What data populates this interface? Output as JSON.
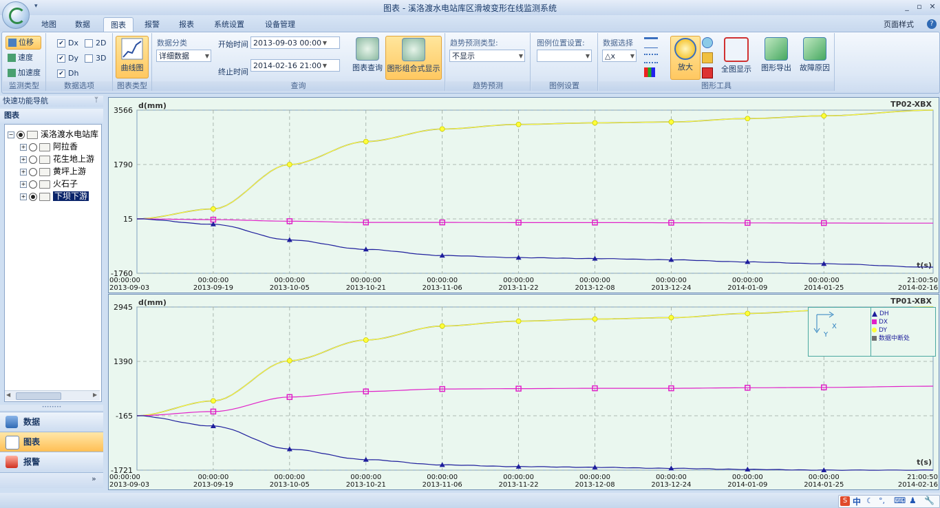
{
  "window": {
    "title": "图表 - 溪洛渡水电站库区滑坡变形在线监测系统",
    "min": "_",
    "max": "▫",
    "close": "✕"
  },
  "tabs": [
    {
      "label": "地图"
    },
    {
      "label": "数据"
    },
    {
      "label": "图表"
    },
    {
      "label": "报警"
    },
    {
      "label": "报表"
    },
    {
      "label": "系统设置"
    },
    {
      "label": "设备管理"
    }
  ],
  "active_tab": "图表",
  "page_style": "页面样式",
  "ribbon": {
    "monitor_type": {
      "label": "监测类型",
      "items": [
        "位移",
        "速度",
        "加速度"
      ]
    },
    "data_options": {
      "label": "数据选项",
      "checks": [
        "Dx",
        "Dy",
        "Dh"
      ],
      "modes": [
        "2D",
        "3D"
      ]
    },
    "chart_type": {
      "label": "图表类型",
      "button": "曲线图"
    },
    "query": {
      "label": "查询",
      "category_label": "数据分类",
      "category_value": "详细数据",
      "start_label": "开始时间",
      "start_value": "2013-09-03 00:00",
      "end_label": "终止时间",
      "end_value": "2014-02-16 21:00",
      "query_button": "图表查询",
      "combo_button": "图形组合式显示"
    },
    "trend": {
      "label": "趋势预测",
      "type_label": "趋势预测类型:",
      "type_value": "不显示"
    },
    "legend": {
      "label": "图例设置",
      "pos_label": "图例位置设置:",
      "pos_value": ""
    },
    "tools": {
      "label": "图形工具",
      "data_select_label": "数据选择",
      "data_select_value": "△x",
      "zoom": "放大",
      "fullview": "全图显示",
      "export": "图形导出",
      "fault": "故障原因"
    }
  },
  "nav": {
    "header": "快速功能导航",
    "pin": "ᛘ",
    "tree_title": "图表",
    "tree": [
      {
        "label": "溪洛渡水电站库",
        "level": 0,
        "selected": false,
        "checked": true
      },
      {
        "label": "阿拉香",
        "level": 1,
        "selected": false,
        "checked": false
      },
      {
        "label": "花生地上游",
        "level": 1,
        "selected": false,
        "checked": false
      },
      {
        "label": "黄坪上游",
        "level": 1,
        "selected": false,
        "checked": false
      },
      {
        "label": "火石子",
        "level": 1,
        "selected": false,
        "checked": false
      },
      {
        "label": "下坝下游",
        "level": 1,
        "selected": true,
        "checked": true
      }
    ],
    "buttons": [
      {
        "label": "数据"
      },
      {
        "label": "图表"
      },
      {
        "label": "报警"
      }
    ],
    "more": "»"
  },
  "x_ticks": [
    {
      "time": "00:00:00",
      "date": "2013-09-03"
    },
    {
      "time": "00:00:00",
      "date": "2013-09-19"
    },
    {
      "time": "00:00:00",
      "date": "2013-10-05"
    },
    {
      "time": "00:00:00",
      "date": "2013-10-21"
    },
    {
      "time": "00:00:00",
      "date": "2013-11-06"
    },
    {
      "time": "00:00:00",
      "date": "2013-11-22"
    },
    {
      "time": "00:00:00",
      "date": "2013-12-08"
    },
    {
      "time": "00:00:00",
      "date": "2013-12-24"
    },
    {
      "time": "00:00:00",
      "date": "2014-01-09"
    },
    {
      "time": "00:00:00",
      "date": "2014-01-25"
    },
    {
      "time": "21:00:50",
      "date": "2014-02-16"
    }
  ],
  "legend_items": [
    {
      "label": "DH",
      "color": "#1e1e9c",
      "marker": "triangle"
    },
    {
      "label": "DX",
      "color": "#e020c8",
      "marker": "square"
    },
    {
      "label": "DY",
      "color": "#ffff3a",
      "marker": "circle"
    },
    {
      "label": "数据中断处",
      "color": "#707070",
      "marker": "square"
    }
  ],
  "axis_icon": {
    "x": "X",
    "y": "Y"
  },
  "chart_data": [
    {
      "type": "line",
      "title": "TP02-XBX",
      "ylabel": "d(mm)",
      "xlabel": "t(s)",
      "yticks": [
        3566,
        1790,
        15,
        -1760
      ],
      "ylim": [
        -1760,
        3566
      ],
      "x": [
        0,
        16,
        32,
        48,
        64,
        80,
        96,
        112,
        128,
        144,
        166.9
      ],
      "series": [
        {
          "name": "DY",
          "color": "#ffff3a",
          "values": [
            15,
            340,
            1790,
            2540,
            2950,
            3100,
            3150,
            3180,
            3290,
            3380,
            3566
          ]
        },
        {
          "name": "DX",
          "color": "#e020c8",
          "values": [
            15,
            -10,
            -60,
            -100,
            -100,
            -105,
            -105,
            -110,
            -115,
            -120,
            -125
          ]
        },
        {
          "name": "DH",
          "color": "#1e1e9c",
          "values": [
            15,
            -160,
            -670,
            -980,
            -1180,
            -1250,
            -1280,
            -1320,
            -1390,
            -1450,
            -1560
          ]
        }
      ]
    },
    {
      "type": "line",
      "title": "TP01-XBX",
      "ylabel": "d(mm)",
      "xlabel": "t(s)",
      "yticks": [
        2945,
        1390,
        -165,
        -1721
      ],
      "ylim": [
        -1721,
        2945
      ],
      "x": [
        0,
        16,
        32,
        48,
        64,
        80,
        96,
        112,
        128,
        144,
        166.9
      ],
      "series": [
        {
          "name": "DY",
          "color": "#ffff3a",
          "values": [
            -165,
            260,
            1410,
            2000,
            2400,
            2540,
            2600,
            2640,
            2760,
            2850,
            2945
          ]
        },
        {
          "name": "DX",
          "color": "#e020c8",
          "values": [
            -165,
            -45,
            370,
            530,
            600,
            610,
            620,
            620,
            635,
            645,
            680
          ]
        },
        {
          "name": "DH",
          "color": "#1e1e9c",
          "values": [
            -165,
            -460,
            -1120,
            -1420,
            -1570,
            -1620,
            -1640,
            -1670,
            -1700,
            -1720,
            -1721
          ]
        }
      ]
    }
  ],
  "tray": {
    "ime": "中",
    "icons": [
      "S",
      "☾",
      "°,",
      "⌨",
      "♟",
      "🔧"
    ]
  }
}
